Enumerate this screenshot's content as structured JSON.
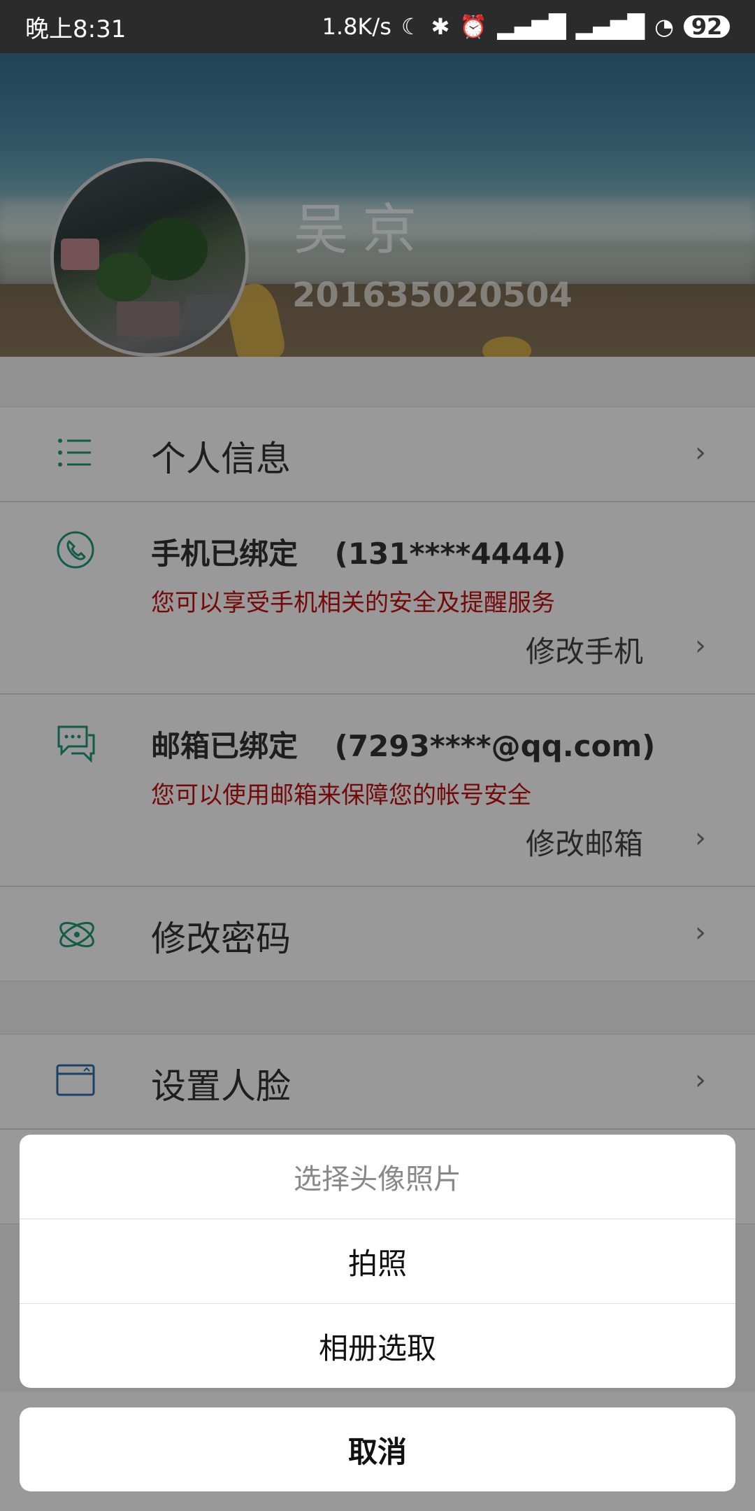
{
  "status_bar": {
    "time": "晚上8:31",
    "network_speed": "1.8K/s",
    "battery": "92",
    "icons": [
      "moon-icon",
      "bluetooth-icon",
      "alarm-icon",
      "signal-icon",
      "hd-signal-icon",
      "wifi-icon",
      "battery-icon"
    ]
  },
  "profile": {
    "name": "吴京",
    "student_id": "201635020504"
  },
  "menu": {
    "personal_info": "个人信息",
    "phone": {
      "title": "手机已绑定",
      "number": "(131****4444)",
      "desc": "您可以享受手机相关的安全及提醒服务",
      "action": "修改手机"
    },
    "email": {
      "title": "邮箱已绑定",
      "address": "(7293****@qq.com)",
      "desc": "您可以使用邮箱来保障您的帐号安全",
      "action": "修改邮箱"
    },
    "change_password": "修改密码",
    "set_face": "设置人脸"
  },
  "sheet": {
    "title": "选择头像照片",
    "take_photo": "拍照",
    "choose_album": "相册选取",
    "cancel": "取消"
  },
  "colors": {
    "accent_icon": "#1f9a7c",
    "warning_text": "#c21010"
  }
}
